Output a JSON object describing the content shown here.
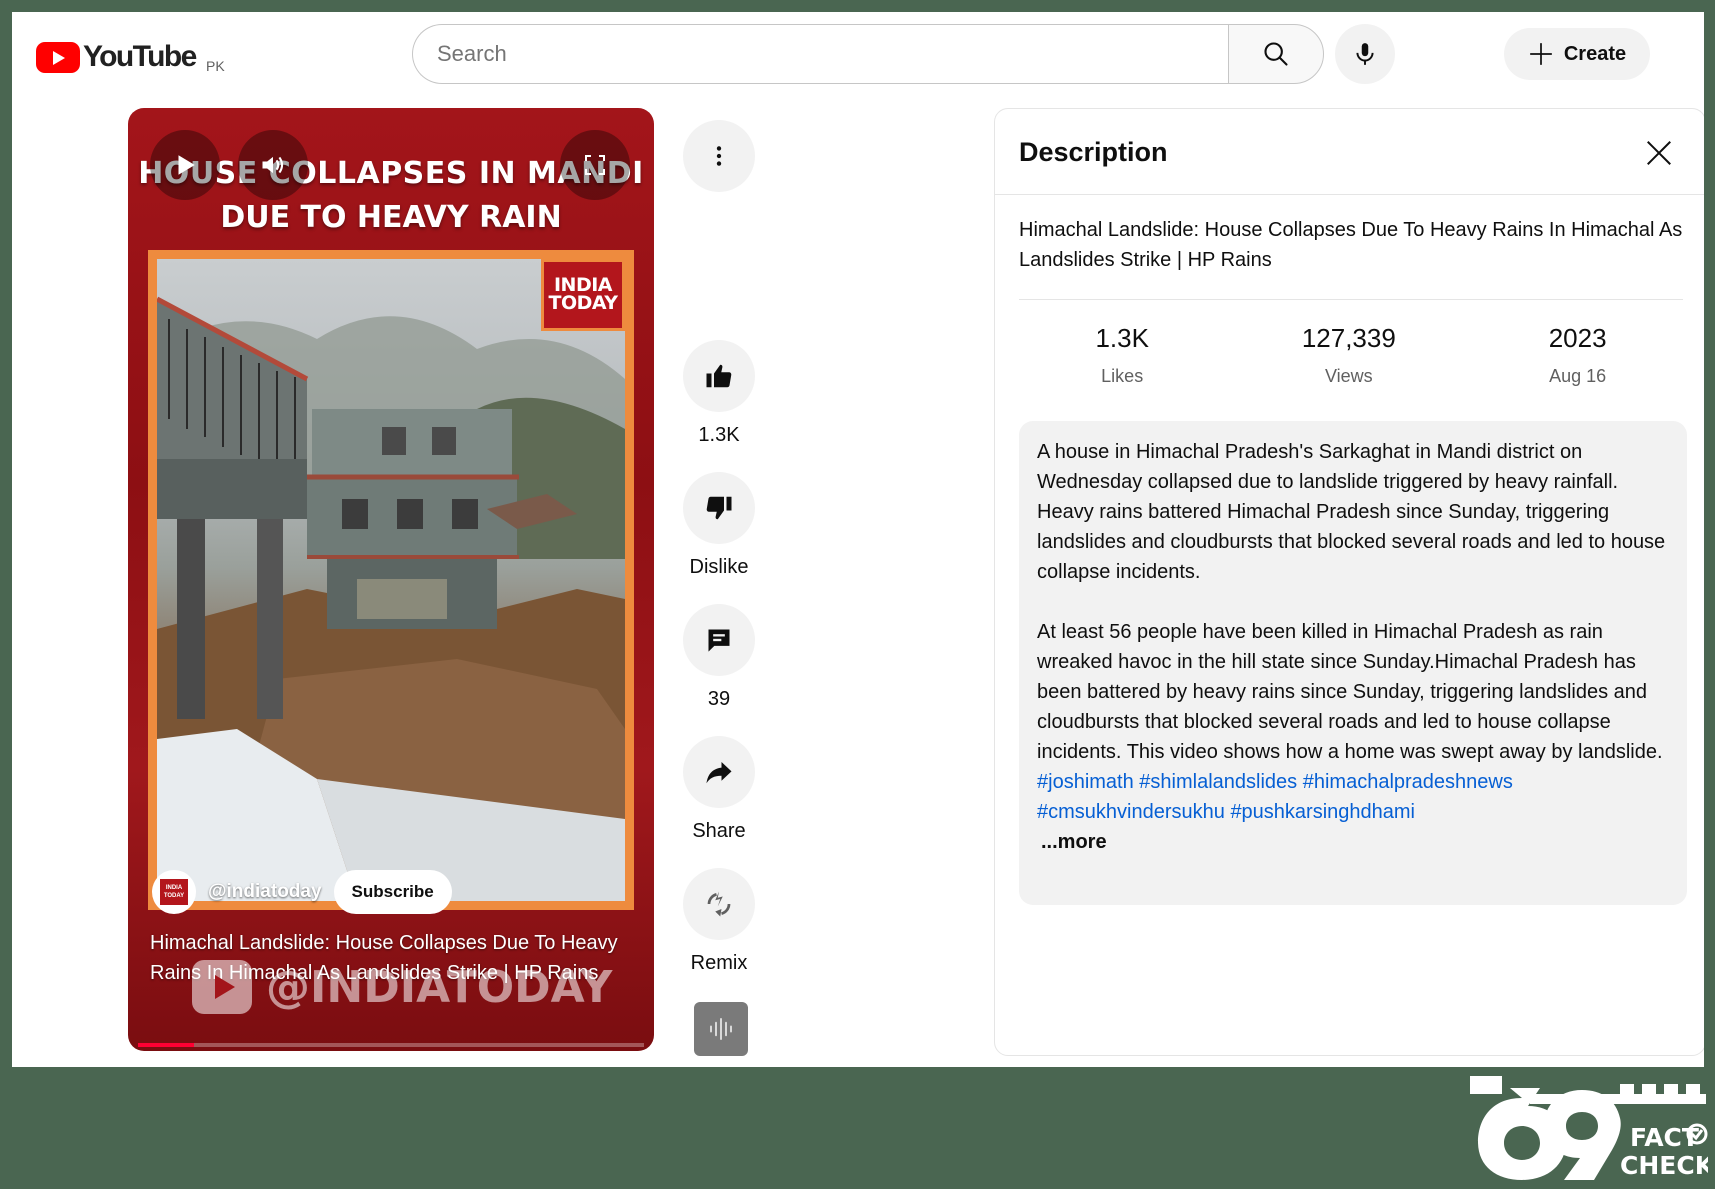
{
  "header": {
    "logo_text": "YouTube",
    "region": "PK",
    "search_placeholder": "Search",
    "create_label": "Create"
  },
  "video": {
    "banner_line1": "HOUSE COLLAPSES IN MANDI",
    "banner_line2": "DUE TO HEAVY RAIN",
    "brand_line1": "INDIA",
    "brand_line2": "TODAY",
    "channel_handle": "@indiatoday",
    "subscribe_label": "Subscribe",
    "title": "Himachal Landslide: House Collapses Due To Heavy Rains In Himachal As Landslides Strike | HP Rains",
    "watermark": "@INDIATODAY",
    "progress": 0.11
  },
  "actions": {
    "likes": "1.3K",
    "dislike_label": "Dislike",
    "comments": "39",
    "share_label": "Share",
    "remix_label": "Remix"
  },
  "description": {
    "panel_title": "Description",
    "video_title": "Himachal Landslide: House Collapses Due To Heavy Rains In Himachal As Landslides Strike | HP Rains",
    "stats": [
      {
        "value": "1.3K",
        "label": "Likes"
      },
      {
        "value": "127,339",
        "label": "Views"
      },
      {
        "value": "2023",
        "label": "Aug 16"
      }
    ],
    "paragraph1": "A house in Himachal Pradesh's Sarkaghat in Mandi district on Wednesday collapsed due to landslide triggered by heavy rainfall. Heavy rains battered Himachal Pradesh since Sunday, triggering landslides and cloudbursts that blocked several roads and led to house collapse incidents.",
    "paragraph2": "At least 56 people have been killed in Himachal Pradesh as rain wreaked havoc in the hill state since Sunday.Himachal Pradesh has been battered by heavy rains since Sunday, triggering landslides and cloudbursts that blocked several roads and led to house collapse incidents. This video shows how a home was swept away by landslide.",
    "hashtags": [
      "#joshimath",
      "#shimlalandslides",
      "#himachalpradeshnews",
      "#cmsukhvindersukhu",
      "#pushkarsinghdhami"
    ],
    "more_label": "...more"
  },
  "overlay": {
    "fact_line1": "FACT",
    "fact_line2": "CHECK"
  },
  "colors": {
    "youtube_red": "#ff0000",
    "video_bg": "#a3151a",
    "link_blue": "#065fd4",
    "frame_border": "#4a6651",
    "scene_border": "#ee8b3e"
  }
}
